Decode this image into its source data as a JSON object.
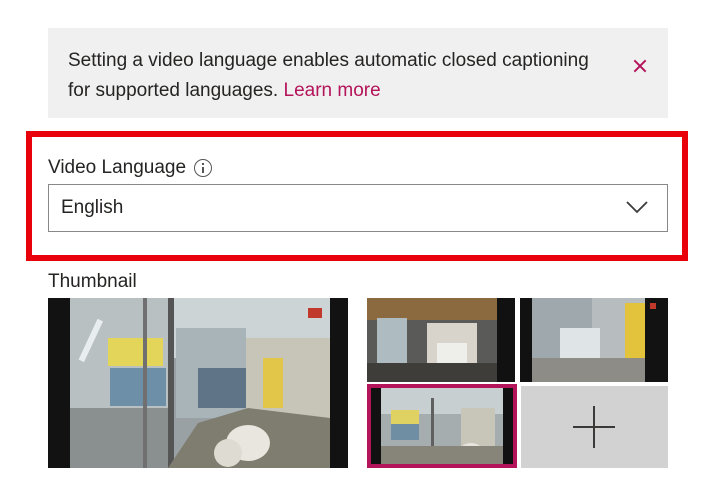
{
  "banner": {
    "message": "Setting a video language enables automatic closed captioning for supported languages.",
    "link_text": "Learn more",
    "close_icon": "close-icon"
  },
  "video_language": {
    "label": "Video Language",
    "info_icon": "info-icon",
    "selected_value": "English",
    "chevron_icon": "chevron-down-icon"
  },
  "thumbnail": {
    "label": "Thumbnail",
    "add_icon": "plus-icon"
  },
  "colors": {
    "accent": "#b4145a",
    "highlight": "#e8000b",
    "banner_bg": "#f0f0f0"
  }
}
